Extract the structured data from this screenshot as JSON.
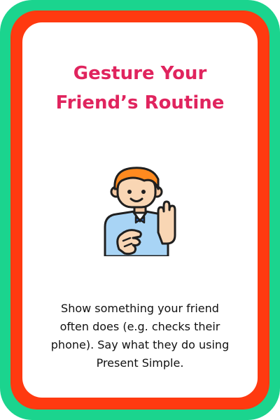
{
  "card": {
    "colors": {
      "outer_border": "#1bd48e",
      "inner_border": "#ff3a10",
      "background": "#ffffff",
      "title": "#e0245e",
      "text": "#111111"
    },
    "title_lines": [
      "Gesture Your",
      "Friend’s Routine"
    ],
    "illustration_icon": "person-waving-icon",
    "instruction_lines": [
      "Show something your friend",
      "often does (e.g. checks their",
      "phone). Say what they do using",
      "Present Simple."
    ]
  }
}
